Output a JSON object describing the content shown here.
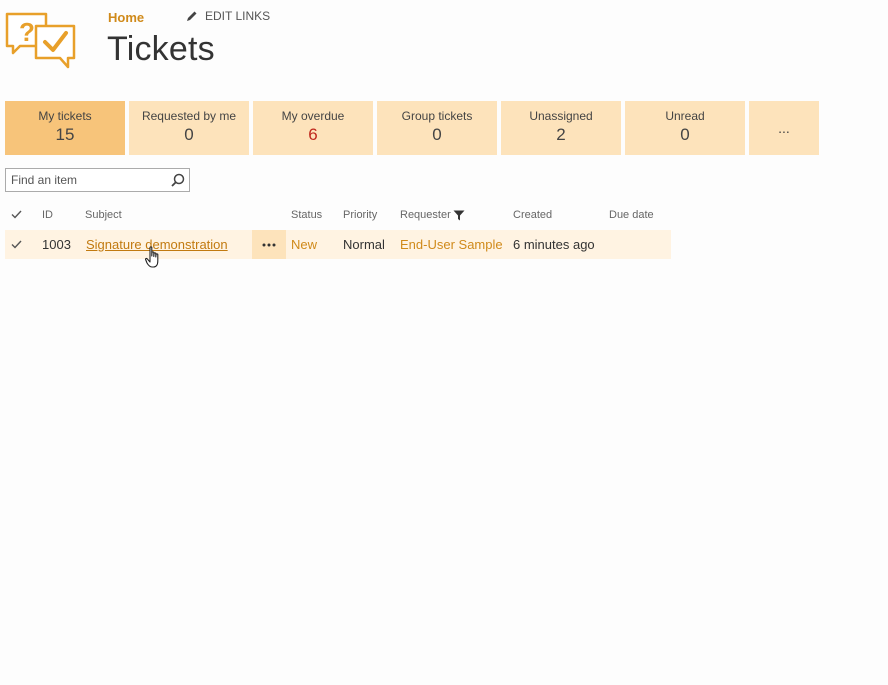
{
  "nav": {
    "home": "Home",
    "edit_links": "EDIT LINKS"
  },
  "page": {
    "title": "Tickets"
  },
  "tiles": [
    {
      "label": "My tickets",
      "count": "15"
    },
    {
      "label": "Requested by me",
      "count": "0"
    },
    {
      "label": "My overdue",
      "count": "6"
    },
    {
      "label": "Group tickets",
      "count": "0"
    },
    {
      "label": "Unassigned",
      "count": "2"
    },
    {
      "label": "Unread",
      "count": "0"
    }
  ],
  "tiles_more": "...",
  "search": {
    "placeholder": "Find an item"
  },
  "table": {
    "columns": {
      "id": "ID",
      "subject": "Subject",
      "status": "Status",
      "priority": "Priority",
      "requester": "Requester",
      "created": "Created",
      "due": "Due date"
    },
    "rows": [
      {
        "id": "1003",
        "subject": "Signature demonstration",
        "status": "New",
        "priority": "Normal",
        "requester": "End-User Sample",
        "created": "6 minutes ago",
        "due": ""
      }
    ]
  },
  "colors": {
    "accent": "#d08a1a",
    "tile": "#fde3bb",
    "tile_active": "#f7c47a",
    "overdue": "#c0291d",
    "row_highlight": "#fff3e2"
  },
  "icons": [
    "tickets-logo-icon",
    "pencil-icon",
    "search-icon",
    "check-icon",
    "filter-icon",
    "ellipsis-icon",
    "hand-cursor-icon"
  ]
}
